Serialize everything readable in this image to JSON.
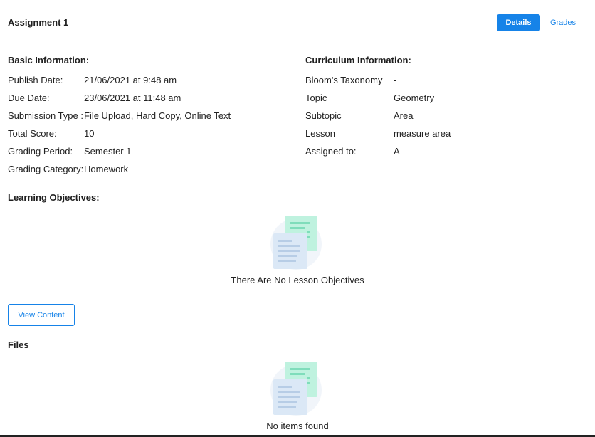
{
  "header": {
    "title": "Assignment 1",
    "details_label": "Details",
    "grades_label": "Grades"
  },
  "basic_info": {
    "heading": "Basic Information:",
    "rows": [
      {
        "label": "Publish Date:",
        "value": "21/06/2021 at 9:48 am"
      },
      {
        "label": "Due Date:",
        "value": "23/06/2021 at 11:48 am"
      },
      {
        "label": "Submission Type :",
        "value": "File Upload, Hard Copy, Online Text"
      },
      {
        "label": "Total Score:",
        "value": "10"
      },
      {
        "label": "Grading Period:",
        "value": "Semester 1"
      },
      {
        "label": "Grading Category:",
        "value": "Homework"
      }
    ]
  },
  "curriculum_info": {
    "heading": "Curriculum Information:",
    "rows": [
      {
        "label": "Bloom's Taxonomy",
        "value": "-"
      },
      {
        "label": "Topic",
        "value": "Geometry"
      },
      {
        "label": "Subtopic",
        "value": "Area"
      },
      {
        "label": "Lesson",
        "value": "measure area"
      },
      {
        "label": "Assigned to:",
        "value": "A"
      }
    ]
  },
  "learning_objectives": {
    "heading": "Learning Objectives:",
    "icon": "documents-icon",
    "empty_text": "There Are No Lesson Objectives"
  },
  "view_content_label": "View Content",
  "files": {
    "heading": "Files",
    "icon": "documents-icon",
    "empty_text": "No items found"
  },
  "colors": {
    "accent": "#1683e8",
    "icon_green": "#bff2df",
    "icon_blue": "#dbe8f6"
  }
}
